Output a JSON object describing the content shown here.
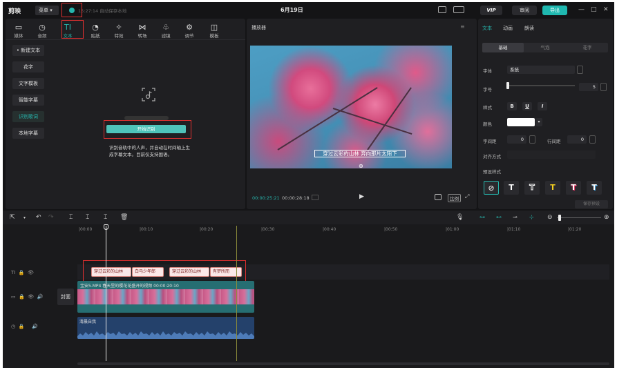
{
  "titlebar": {
    "logo": "剪映",
    "menu_label": "菜单",
    "save_status": "15:27:14 自动保存本地",
    "doc_title": "6月19日",
    "vip_label": "VIP",
    "review_label": "审阅",
    "export_label": "导出",
    "min_label": "—",
    "max_label": "□",
    "close_label": "✕"
  },
  "tools": [
    {
      "icon": "▭",
      "label": "媒体"
    },
    {
      "icon": "◷",
      "label": "音频"
    },
    {
      "icon": "TI",
      "label": "文本"
    },
    {
      "icon": "◔",
      "label": "贴纸"
    },
    {
      "icon": "✧",
      "label": "特效"
    },
    {
      "icon": "⋈",
      "label": "转场"
    },
    {
      "icon": "♧",
      "label": "滤镜"
    },
    {
      "icon": "⚙",
      "label": "调节"
    },
    {
      "icon": "◫",
      "label": "模板"
    }
  ],
  "sidebar": {
    "items": [
      "• 新建文本",
      "花字",
      "文字模板",
      "智能字幕",
      "识别歌词",
      "本地字幕"
    ]
  },
  "lyrics": {
    "start_label": "开始识别",
    "hint": "识别音轨中的人声，并自动在时间轴上生成字幕文本。目前仅支持国语。"
  },
  "player": {
    "title": "播放器",
    "subtitle": "穿过云彩的山林  奔向那片太阳下",
    "time_current": "00:00:25:21",
    "time_total": "00:00:28:18",
    "ratio_label": "比例"
  },
  "right": {
    "tabs": [
      "文本",
      "动画",
      "朗读"
    ],
    "subtabs": [
      "基础",
      "气泡",
      "花字"
    ],
    "font_label": "字体",
    "font_value": "系统",
    "size_label": "字号",
    "size_value": "5",
    "style_label": "样式",
    "style_buttons": [
      "B",
      "U",
      "I"
    ],
    "color_label": "颜色",
    "spacing_label": "字间距",
    "spacing_value": "0",
    "line_spacing_label": "行间距",
    "line_spacing_value": "0",
    "align_label": "对齐方式",
    "preset_label": "预设样式",
    "preset_glyph": "T",
    "save_preset_label": "保存预设"
  },
  "timeline": {
    "ruler": [
      "|00:00",
      "|00:10",
      "|00:20",
      "|00:30",
      "|00:40",
      "|00:50",
      "|01:00",
      "|01:10",
      "|01:20"
    ],
    "text_clips": [
      "穿过云彩的山林",
      "白马少年郎",
      "穿过云彩的山林",
      "有梦所而"
    ],
    "cover_label": "封面",
    "video_clip_label": "宝安5.MP4  春天里的樱花花盛开的视频  00:00:20:10",
    "audio_clip_label": "清晨自我"
  },
  "colors": {
    "accent": "#26b6ad",
    "highlight_box": "#e03030",
    "export_button": "#1fb8b0"
  }
}
